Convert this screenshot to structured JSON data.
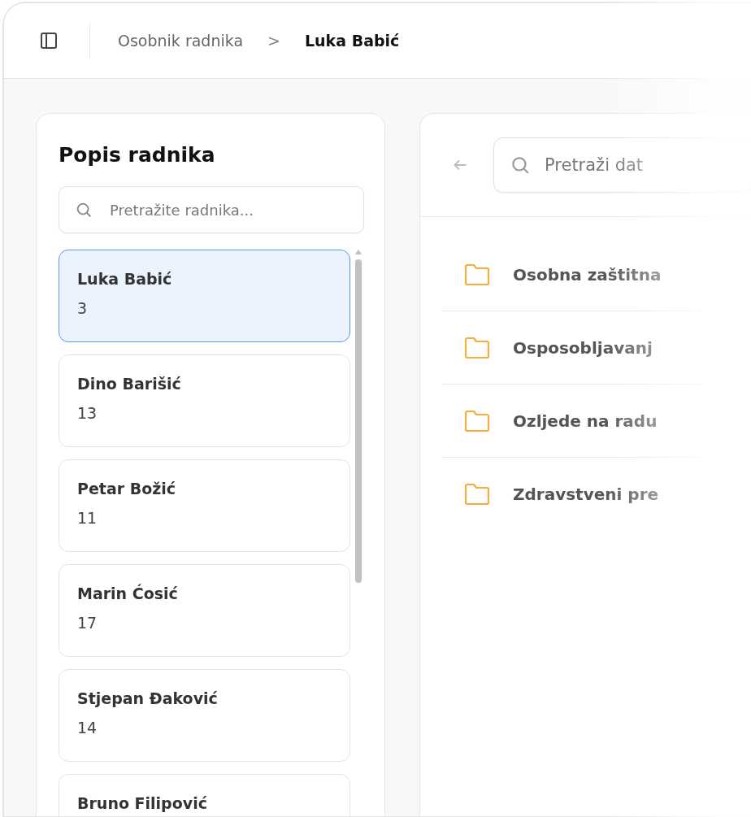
{
  "breadcrumb": {
    "parent": "Osobnik radnika",
    "separator": ">",
    "current": "Luka Babić"
  },
  "employees_panel": {
    "title": "Popis radnika",
    "search": {
      "placeholder": "Pretražite radnika..."
    },
    "items": [
      {
        "name": "Luka Babić",
        "count": "3",
        "selected": true
      },
      {
        "name": "Dino Barišić",
        "count": "13",
        "selected": false
      },
      {
        "name": "Petar Božić",
        "count": "11",
        "selected": false
      },
      {
        "name": "Marin Ćosić",
        "count": "17",
        "selected": false
      },
      {
        "name": "Stjepan Đaković",
        "count": "14",
        "selected": false
      },
      {
        "name": "Bruno Filipović",
        "selected": false
      }
    ]
  },
  "files_panel": {
    "search": {
      "placeholder": "Pretraži dat"
    },
    "folders": [
      {
        "name": "Osobna zaštitna"
      },
      {
        "name": "Osposobljavanj"
      },
      {
        "name": "Ozljede na radu"
      },
      {
        "name": "Zdravstveni pre"
      }
    ]
  }
}
